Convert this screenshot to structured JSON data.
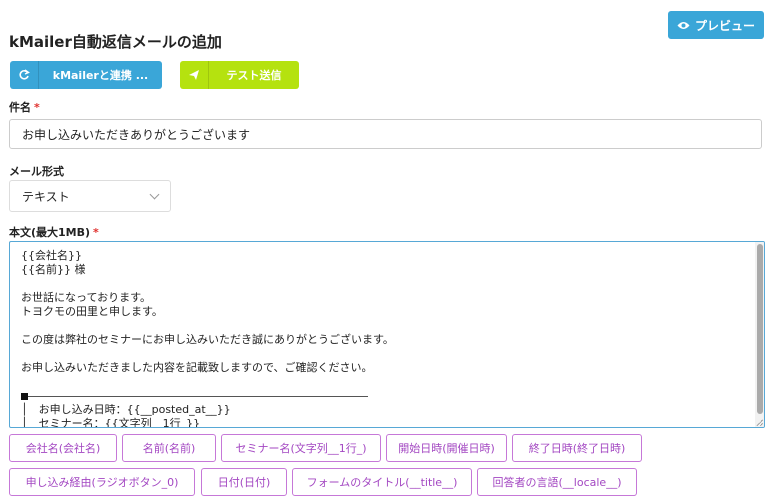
{
  "header": {
    "title": "kMailer自動返信メールの追加",
    "preview_label": "プレビュー"
  },
  "toolbar": {
    "kmailer_label": "kMailerと連携 ...",
    "test_label": "テスト送信"
  },
  "form": {
    "subject_label": "件名",
    "subject_value": "お申し込みいただきありがとうございます",
    "format_label": "メール形式",
    "format_value": "テキスト",
    "body_label": "本文(最大1MB)",
    "required_mark": "*",
    "body_lines": [
      "{{会社名}}",
      "{{名前}} 様",
      "",
      "お世話になっております。",
      "トヨクモの田里と申します。",
      "",
      "この度は弊社のセミナーにお申し込みいただき誠にありがとうございます。",
      "",
      "お申し込みいただきました内容を記載致しますので、ご確認ください。",
      "",
      "",
      "│　お申し込み日時：{{__posted_at__}}",
      "│　セミナー名：{{文字列__1行_}}"
    ]
  },
  "tags": [
    "会社名(会社名)",
    "名前(名前)",
    "セミナー名(文字列__1行_)",
    "開始日時(開催日時)",
    "終了日時(終了日時)",
    "申し込み経由(ラジオボタン_0)",
    "日付(日付)",
    "フォームのタイトル(__title__)",
    "回答者の言語(__locale__)"
  ],
  "colors": {
    "primary": "#3aa6d8",
    "test_button": "#b5e20f",
    "tag": "#a347c2",
    "required": "#e0322f"
  }
}
